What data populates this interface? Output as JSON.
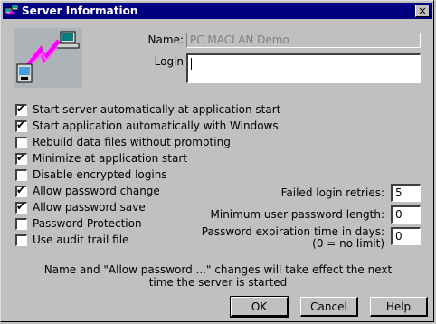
{
  "window": {
    "title": "Server Information",
    "close_glyph": "✕"
  },
  "fields": {
    "name_label": "Name:",
    "name_value": "PC MACLAN Demo",
    "login_label": "Login",
    "login_value": ""
  },
  "options": [
    {
      "label": "Start server automatically at application start",
      "checked": true
    },
    {
      "label": "Start application automatically with Windows",
      "checked": true
    },
    {
      "label": "Rebuild data files without prompting",
      "checked": false
    },
    {
      "label": "Minimize at application start",
      "checked": true
    },
    {
      "label": "Disable encrypted logins",
      "checked": false
    },
    {
      "label": "Allow password change",
      "checked": true
    },
    {
      "label": "Allow password save",
      "checked": true
    },
    {
      "label": "Password Protection",
      "checked": false
    },
    {
      "label": "Use audit trail file",
      "checked": false
    }
  ],
  "settings": {
    "failed_retries_label": "Failed login retries:",
    "failed_retries_value": "5",
    "min_length_label": "Minimum user password length:",
    "min_length_value": "0",
    "expiration_label_line1": "Password expiration time in days:",
    "expiration_label_line2": "(0 = no limit)",
    "expiration_value": "0"
  },
  "note": "Name and \"Allow password ...\" changes will take effect the next time the server is started",
  "buttons": {
    "ok": "OK",
    "cancel": "Cancel",
    "help": "Help"
  },
  "icons": {
    "title_icon": "computer-network-icon",
    "illustration": "server-network-illustration",
    "check": "✔"
  }
}
